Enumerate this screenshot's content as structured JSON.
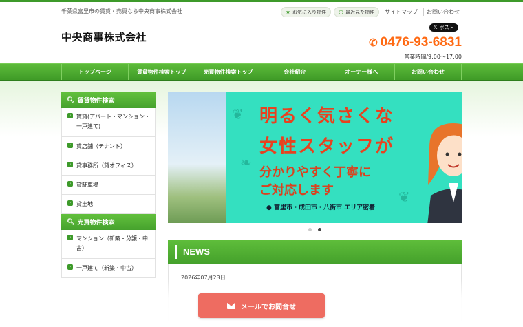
{
  "header": {
    "tagline": "千葉県富里市の賃貸・売買なら中央商事株式会社",
    "site_name": "中央商事株式会社",
    "favorites_label": "お気に入り物件",
    "recent_label": "最近見た物件",
    "sitemap_label": "サイトマップ",
    "contact_label": "お問い合わせ",
    "x_post_label": "ポスト",
    "phone": "0476-93-6831",
    "hours": "営業時間/9:00～17:00"
  },
  "nav": {
    "items": [
      "トップページ",
      "賃貸物件検索トップ",
      "売買物件検索トップ",
      "会社紹介",
      "オーナー様へ",
      "お問い合わせ"
    ]
  },
  "sidebar": {
    "rental_heading": "賃貸物件検索",
    "rental_items": [
      "賃貸(アパート・マンション・一戸建て)",
      "貸店舗（テナント）",
      "貸事務所（貸オフィス）",
      "貸駐車場",
      "貸土地"
    ],
    "sale_heading": "売買物件検索",
    "sale_items": [
      "マンション（新築・分譲・中古）",
      "一戸建て（新築・中古）"
    ]
  },
  "banner": {
    "line1": "明るく気さくな",
    "line2": "女性スタッフが",
    "line3": "分かりやすく丁寧に",
    "line4": "ご対応します",
    "area": "● 富里市・成田市・八街市 エリア密着"
  },
  "news": {
    "title": "NEWS",
    "date": "2026年07月23日"
  },
  "cta": {
    "mail_label": "メールでお問合せ"
  },
  "colors": {
    "brand_green": "#3d9a2a",
    "phone_orange": "#ff6a13",
    "banner_teal": "#34e0c0",
    "cta_red": "#ee6c61"
  }
}
